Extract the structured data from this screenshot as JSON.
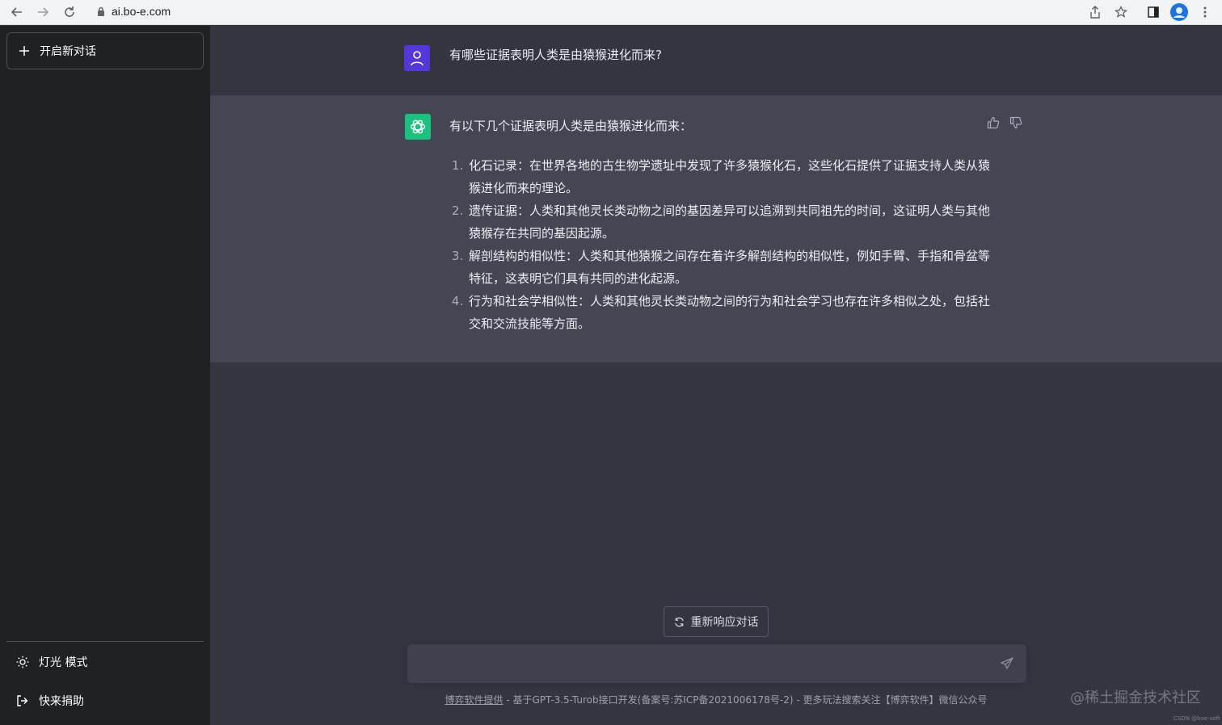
{
  "browser": {
    "url": "ai.bo-e.com"
  },
  "sidebar": {
    "new_chat_label": "开启新对话",
    "items": [
      {
        "label": "灯光 模式",
        "icon": "sun-icon"
      },
      {
        "label": "快来捐助",
        "icon": "logout-icon"
      }
    ]
  },
  "conversation": {
    "user_question": "有哪些证据表明人类是由猿猴进化而来?",
    "assistant_intro": "有以下几个证据表明人类是由猿猴进化而来：",
    "assistant_points": [
      "化石记录：在世界各地的古生物学遗址中发现了许多猿猴化石，这些化石提供了证据支持人类从猿猴进化而来的理论。",
      "遗传证据：人类和其他灵长类动物之间的基因差异可以追溯到共同祖先的时间，这证明人类与其他猿猴存在共同的基因起源。",
      "解剖结构的相似性：人类和其他猿猴之间存在着许多解剖结构的相似性，例如手臂、手指和骨盆等特征，这表明它们具有共同的进化起源。",
      "行为和社会学相似性：人类和其他灵长类动物之间的行为和社会学习也存在许多相似之处，包括社交和交流技能等方面。"
    ]
  },
  "regenerate_label": "重新响应对话",
  "input": {
    "placeholder": ""
  },
  "footer": {
    "link": "博弈软件提供",
    "text": " - 基于GPT-3.5-Turob接口开发(备案号:苏ICP备2021006178号-2) - 更多玩法搜索关注【博弈软件】微信公众号"
  },
  "watermark": "@稀土掘金技术社区",
  "watermark_small": "CSDN @boe-soft",
  "colors": {
    "sidebar_bg": "#202123",
    "main_bg": "#343541",
    "assistant_bg": "#444654",
    "user_avatar": "#5436da",
    "assistant_avatar": "#19c37d"
  }
}
